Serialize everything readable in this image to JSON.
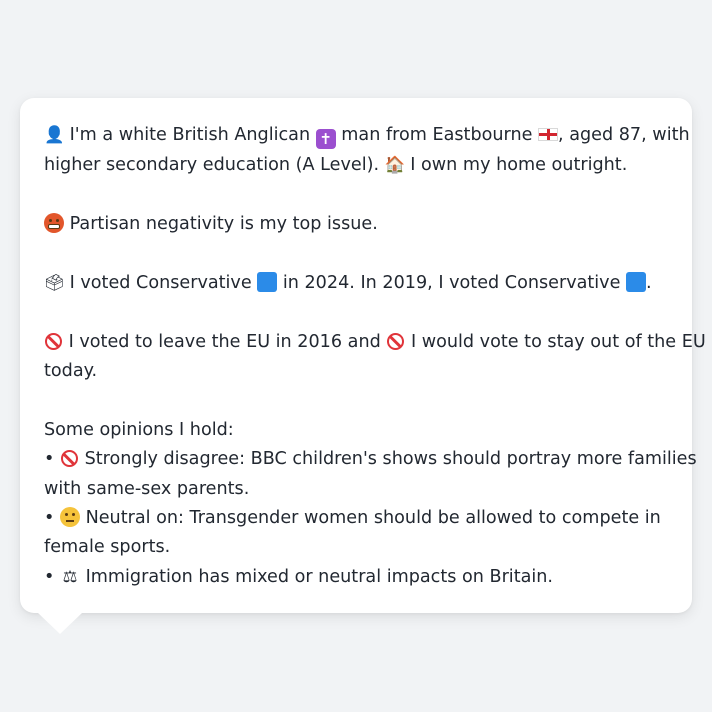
{
  "message": {
    "intro": {
      "icon": "bust-in-silhouette-icon",
      "part1": " I'm a white British Anglican ",
      "part2": " man from Eastbourne ",
      "part3": ", aged 87, with",
      "line2_part1": "higher secondary education (A Level). ",
      "line2_part2": " I own my home outright."
    },
    "top_issue": {
      "icon": "angry-face-icon",
      "text": " Partisan negativity is my top issue."
    },
    "vote": {
      "icon": "ballot-box-icon",
      "part1": " I voted Conservative ",
      "part2": " in 2024. In 2019, I voted Conservative ",
      "part3": "."
    },
    "eu": {
      "part1": " I voted to leave the EU in 2016 and ",
      "part2": " I would vote to stay out of the EU",
      "line2": "today."
    },
    "opinions": {
      "heading": "Some opinions I hold:",
      "bullet": "•",
      "item1_line1": " Strongly disagree: BBC children's shows should portray more families",
      "item1_line2": "with same-sex parents.",
      "item2_line1": " Neutral on: Transgender women should be allowed to compete in",
      "item2_line2": "female sports.",
      "item3_line1": " Immigration has mixed or neutral impacts on Britain."
    },
    "colors": {
      "conservative_blue": "#2b8be8",
      "no_entry_red": "#e0343a",
      "background": "#f1f3f5",
      "bubble": "#ffffff"
    }
  }
}
